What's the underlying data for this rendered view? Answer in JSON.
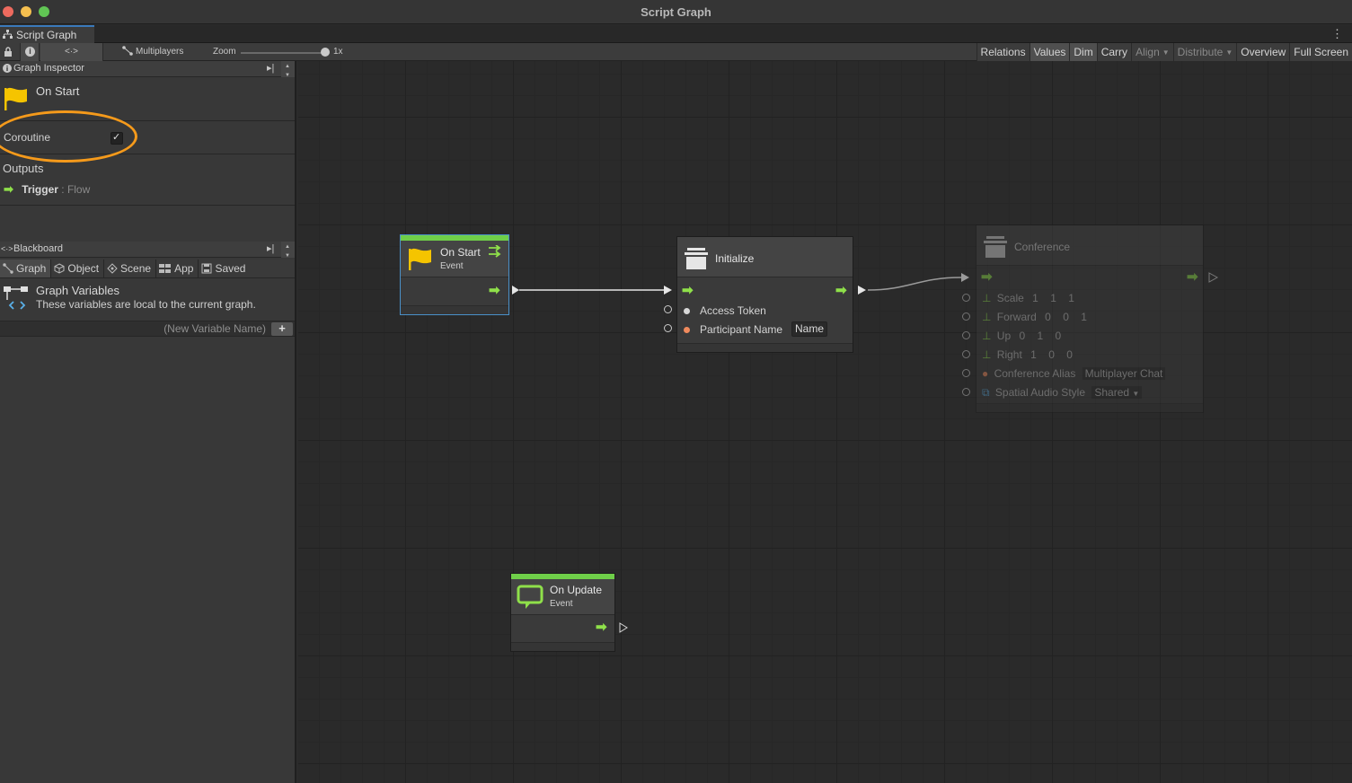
{
  "window": {
    "title": "Script Graph"
  },
  "tab": {
    "label": "Script Graph"
  },
  "toolbar": {
    "multiplayers": "Multiplayers",
    "zoom_label": "Zoom",
    "zoom_value": "1x",
    "zoom_level": 1,
    "buttons": {
      "relations": "Relations",
      "values": "Values",
      "dim": "Dim",
      "carry": "Carry",
      "align": "Align",
      "distribute": "Distribute",
      "overview": "Overview",
      "fullscreen": "Full Screen"
    }
  },
  "inspector": {
    "header": "Graph Inspector",
    "title": "On Start",
    "coroutine_label": "Coroutine",
    "coroutine_checked": true,
    "outputs_label": "Outputs",
    "trigger_name": "Trigger",
    "trigger_type": " : Flow"
  },
  "blackboard": {
    "header": "Blackboard",
    "tabs": [
      "Graph",
      "Object",
      "Scene",
      "App",
      "Saved"
    ],
    "graph_vars_title": "Graph Variables",
    "graph_vars_desc": "These variables are local to the current graph.",
    "new_var_placeholder": "(New Variable Name)",
    "add_label": "+"
  },
  "nodes": {
    "on_start": {
      "title": "On Start",
      "subtitle": "Event"
    },
    "initialize": {
      "title": "Initialize",
      "ports": {
        "access_token": "Access Token",
        "participant_name": "Participant Name",
        "participant_value": "Name"
      }
    },
    "conference": {
      "title": "Conference",
      "scale": {
        "label": "Scale",
        "values": [
          "1",
          "1",
          "1"
        ]
      },
      "forward": {
        "label": "Forward",
        "values": [
          "0",
          "0",
          "1"
        ]
      },
      "up": {
        "label": "Up",
        "values": [
          "0",
          "1",
          "0"
        ]
      },
      "right": {
        "label": "Right",
        "values": [
          "1",
          "0",
          "0"
        ]
      },
      "alias": {
        "label": "Conference Alias",
        "value": "Multiplayer Chat"
      },
      "spatial": {
        "label": "Spatial Audio Style",
        "value": "Shared"
      }
    },
    "on_update": {
      "title": "On Update",
      "subtitle": "Event"
    }
  },
  "colors": {
    "flow_green": "#8fe04a",
    "event_bar": "#6fcf49",
    "highlight": "#f59a1b",
    "flag": "#f5c400",
    "string_port": "#f08a5d"
  }
}
